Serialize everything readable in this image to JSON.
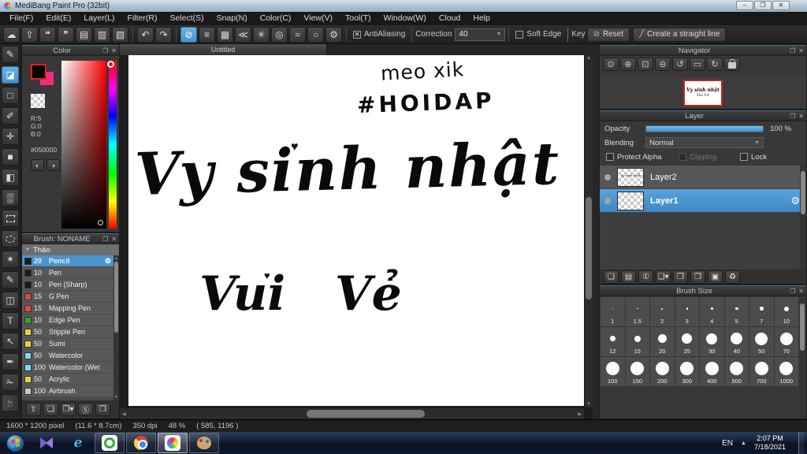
{
  "window": {
    "title": "MediBang Paint Pro (32bit)"
  },
  "icons": {
    "popout": "❐",
    "close": "✕",
    "dropdown": "▼",
    "up": "▲",
    "down": "▼",
    "left": "◀",
    "right": "▶",
    "check": "✕",
    "gear": "⚙",
    "minimize": "–",
    "restore": "❐",
    "win_close": "✕",
    "group_arrow": "▼",
    "heart": "♥"
  },
  "menu": {
    "items": [
      "File(F)",
      "Edit(E)",
      "Layer(L)",
      "Filter(R)",
      "Select(S)",
      "Snap(N)",
      "Color(C)",
      "View(V)",
      "Tool(T)",
      "Window(W)",
      "Cloud",
      "Help"
    ]
  },
  "toolbar": {
    "file_icons": [
      {
        "name": "cloud-icon",
        "glyph": "☁"
      },
      {
        "name": "publish-icon",
        "glyph": "⇧"
      },
      {
        "name": "comment-icon",
        "glyph": "❝"
      },
      {
        "name": "memo-icon",
        "glyph": "❞"
      },
      {
        "name": "document-icon",
        "glyph": "▤"
      },
      {
        "name": "material-panel-icon",
        "glyph": "▥"
      },
      {
        "name": "window-layout-icon",
        "glyph": "▧"
      }
    ],
    "history_icons": [
      {
        "name": "undo-icon",
        "glyph": "↶"
      },
      {
        "name": "redo-icon",
        "glyph": "↷"
      }
    ],
    "snap_icons": [
      {
        "name": "snap-off-icon",
        "glyph": "⊘",
        "selected": true
      },
      {
        "name": "snap-parallel-icon",
        "glyph": "≡"
      },
      {
        "name": "snap-grid-icon",
        "glyph": "▦"
      },
      {
        "name": "snap-vanishing-icon",
        "glyph": "≪"
      },
      {
        "name": "snap-radial-icon",
        "glyph": "✳"
      },
      {
        "name": "snap-concentric-icon",
        "glyph": "◎"
      },
      {
        "name": "snap-curve-icon",
        "glyph": "≈"
      },
      {
        "name": "snap-ellipse-icon",
        "glyph": "○"
      }
    ],
    "settings_icon": "⚙",
    "antialiasing_label": "AntiAliasing",
    "correction_label": "Correction",
    "correction_value": "40",
    "soft_edge_label": "Soft Edge",
    "key_label": "Key",
    "reset_label": "Reset",
    "reset_icon": "⊘",
    "straight_line_label": "Create a straight line",
    "straight_line_icon": "╱"
  },
  "tools": [
    {
      "name": "brush-tool",
      "glyph": "✎"
    },
    {
      "name": "eraser-tool",
      "glyph": "◪",
      "selected": true
    },
    {
      "name": "figure-tool",
      "glyph": "□"
    },
    {
      "name": "dot-pen-tool",
      "glyph": "✐"
    },
    {
      "name": "move-tool",
      "glyph": "✛"
    },
    {
      "name": "fill-tool",
      "glyph": "■"
    },
    {
      "name": "bucket-tool",
      "glyph": "◧"
    },
    {
      "name": "gradient-tool",
      "glyph": "▒"
    },
    {
      "name": "select-tool",
      "shape": "dashed-box"
    },
    {
      "name": "lasso-tool",
      "shape": "dashed-circle"
    },
    {
      "name": "magic-wand-tool",
      "glyph": "✶"
    },
    {
      "name": "select-pen-tool",
      "glyph": "✎"
    },
    {
      "name": "select-eraser-tool",
      "glyph": "◫"
    },
    {
      "name": "text-tool",
      "glyph": "T"
    },
    {
      "name": "operation-tool",
      "glyph": "↖"
    },
    {
      "name": "eyedropper-tool",
      "glyph": "✒"
    },
    {
      "name": "divide-tool",
      "glyph": "✁"
    },
    {
      "name": "hand-tool",
      "glyph": "☞",
      "rotate": true
    }
  ],
  "color_panel": {
    "title": "Color",
    "r_label": "R:5",
    "g_label": "G:0",
    "b_label": "B:0",
    "hex": "#050000",
    "foreground_color": "#050000",
    "secondary_color": "#f02d82",
    "palette_icons": [
      {
        "name": "palette-icon",
        "glyph": "◐"
      },
      {
        "name": "palette-edit-icon",
        "glyph": "◑"
      }
    ]
  },
  "brush_panel": {
    "title": "Brush: NONAME",
    "group": "Thảo",
    "brushes": [
      {
        "size": "20",
        "name": "Pencil",
        "color": "#1c1c1c",
        "selected": true
      },
      {
        "size": "10",
        "name": "Pen",
        "color": "#1c1c1c"
      },
      {
        "size": "10",
        "name": "Pen (Sharp)",
        "color": "#1c1c1c"
      },
      {
        "size": "15",
        "name": "G Pen",
        "color": "#e04545"
      },
      {
        "size": "15",
        "name": "Mapping Pen",
        "color": "#e04545"
      },
      {
        "size": "10",
        "name": "Edge Pen",
        "color": "#2ea62e"
      },
      {
        "size": "50",
        "name": "Stipple Pen",
        "color": "#e6d23c"
      },
      {
        "size": "50",
        "name": "Sumi",
        "color": "#e6d23c"
      },
      {
        "size": "50",
        "name": "Watercolor",
        "color": "#7fd8f2"
      },
      {
        "size": "100",
        "name": "Watercolor (Wet",
        "color": "#7fd8f2"
      },
      {
        "size": "50",
        "name": "Acrylic",
        "color": "#e6d23c"
      },
      {
        "size": "100",
        "name": "Airbrush",
        "color": "#c8c8c8"
      }
    ],
    "footer_icons": [
      {
        "name": "upload-brush-icon",
        "glyph": "⇧"
      },
      {
        "name": "add-brush-icon",
        "glyph": "❏"
      },
      {
        "name": "add-brush-menu-icon",
        "glyph": "❐▾"
      },
      {
        "name": "script-brush-icon",
        "glyph": "Ⓢ"
      },
      {
        "name": "brush-folder-icon",
        "glyph": "❒"
      }
    ]
  },
  "canvas": {
    "tab": "Untitled",
    "note_line1": "meo xik",
    "note_line2": "#HOIDAP",
    "main_line1": "Vy sinh nhật",
    "main_line2": "Vui Vẻ"
  },
  "navigator": {
    "title": "Navigator",
    "icons": [
      {
        "name": "zoom-actual-icon",
        "glyph": "⊙"
      },
      {
        "name": "zoom-in-icon",
        "glyph": "⊕"
      },
      {
        "name": "fit-screen-icon",
        "glyph": "⊡"
      },
      {
        "name": "zoom-out-icon",
        "glyph": "⊖"
      },
      {
        "name": "rotate-left-icon",
        "glyph": "↺"
      },
      {
        "name": "reset-view-icon",
        "glyph": "▭"
      },
      {
        "name": "rotate-right-icon",
        "glyph": "↻"
      },
      {
        "name": "lock-icon",
        "shape": "lock"
      }
    ]
  },
  "layer_panel": {
    "title": "Layer",
    "opacity_label": "Opacity",
    "opacity_value": "100 %",
    "blending_label": "Blending",
    "blending_value": "Normal",
    "protect_alpha_label": "Protect Alpha",
    "clipping_label": "Clipping",
    "lock_label": "Lock",
    "layers": [
      {
        "name": "Layer2",
        "selected": false,
        "thumb_text": "Vy sinh nhật"
      },
      {
        "name": "Layer1",
        "selected": true,
        "thumb_text": ""
      }
    ],
    "footer_icons": [
      {
        "name": "add-layer-icon",
        "glyph": "❏"
      },
      {
        "name": "add-halftone-layer-icon",
        "glyph": "▤"
      },
      {
        "name": "add-1bit-layer-icon",
        "glyph": "①"
      },
      {
        "name": "add-layer-menu-icon",
        "glyph": "❏▾"
      },
      {
        "name": "add-folder-icon",
        "glyph": "❒"
      },
      {
        "name": "duplicate-layer-icon",
        "glyph": "❐"
      },
      {
        "name": "merge-layer-icon",
        "glyph": "▣"
      },
      {
        "name": "delete-layer-icon",
        "glyph": "♻"
      }
    ]
  },
  "brush_size_panel": {
    "title": "Brush Size",
    "sizes": [
      "1",
      "1.5",
      "2",
      "3",
      "4",
      "5",
      "7",
      "10",
      "12",
      "15",
      "20",
      "25",
      "30",
      "40",
      "50",
      "70",
      "100",
      "150",
      "200",
      "300",
      "400",
      "500",
      "700",
      "1000"
    ]
  },
  "status_bar": {
    "dimensions": "1600 * 1200 pixel",
    "physical_size": "(11.6 * 8.7cm)",
    "dpi": "350 dpi",
    "zoom": "48 %",
    "coordinates": "( 585, 1196 )"
  },
  "taskbar": {
    "apps": [
      {
        "name": "kmplayer",
        "framed": false
      },
      {
        "name": "internet-explorer",
        "framed": false,
        "glyph": "e"
      },
      {
        "name": "coccoc",
        "framed": true
      },
      {
        "name": "chrome",
        "framed": true
      },
      {
        "name": "medibang",
        "framed": true,
        "active": true
      },
      {
        "name": "paint",
        "framed": true
      }
    ],
    "language": "EN",
    "tray_arrow": "▲",
    "time": "2:07 PM",
    "date": "7/18/2021"
  }
}
